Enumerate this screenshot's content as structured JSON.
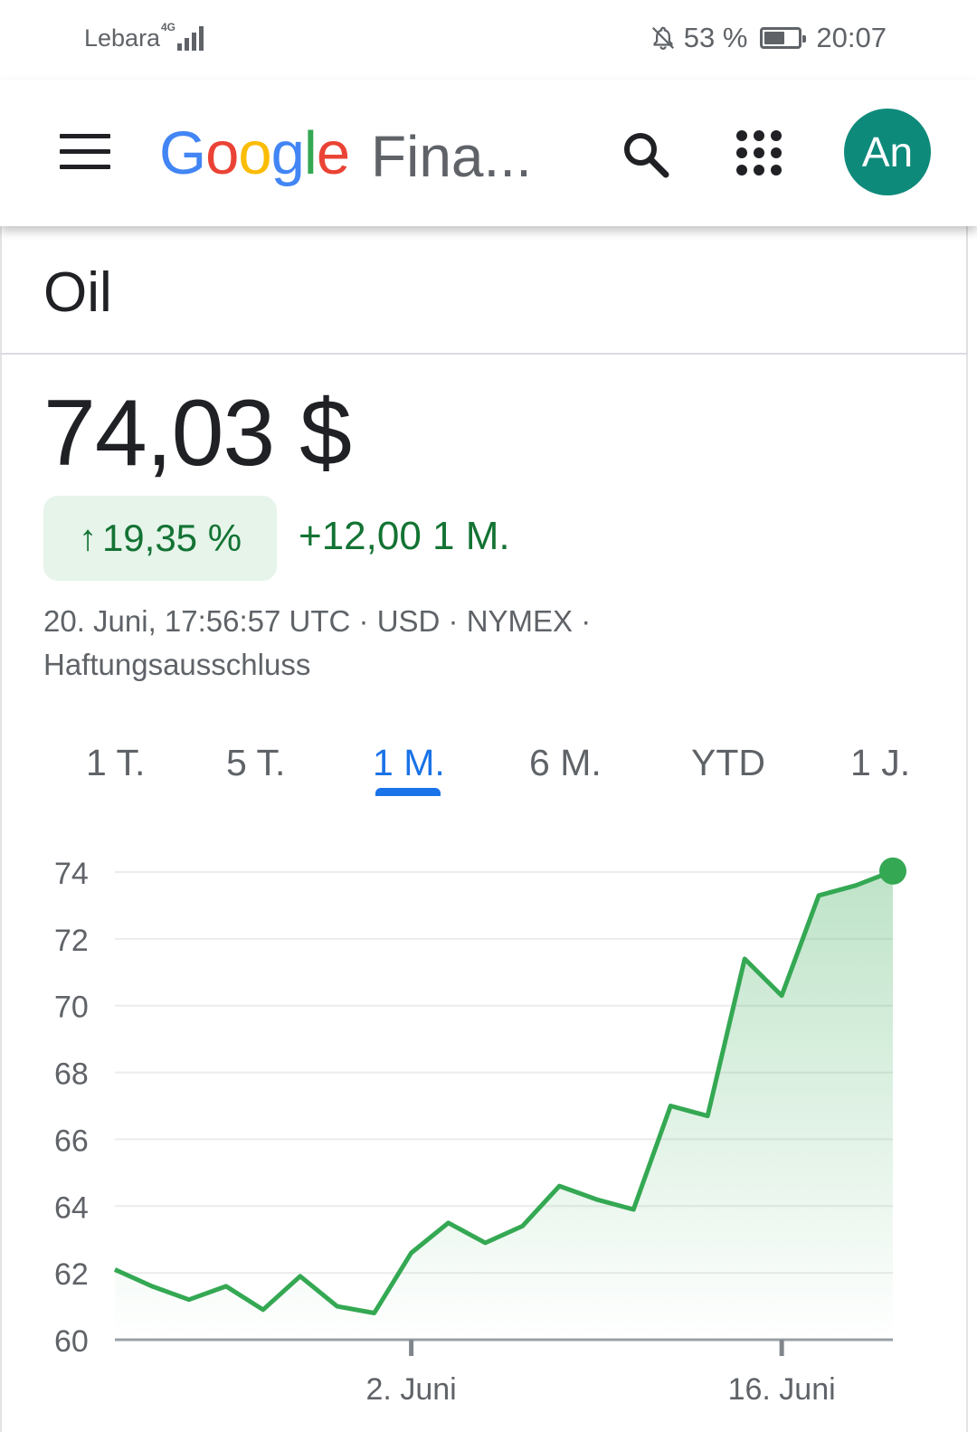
{
  "status_bar": {
    "carrier": "Lebara",
    "network": "4G",
    "battery": "53 %",
    "battery_level": 0.53,
    "time": "20:07"
  },
  "app_bar": {
    "logo": {
      "letters": [
        "G",
        "o",
        "o",
        "g",
        "l",
        "e"
      ]
    },
    "product": "Fina...",
    "avatar_initials": "An",
    "icons": [
      "menu-icon",
      "search-icon",
      "apps-grid-icon",
      "bell-off-icon",
      "signal-icon",
      "battery-icon"
    ]
  },
  "quote": {
    "title": "Oil",
    "price": "74,03 $",
    "change_percent": "19,35 %",
    "change_value": "+12,00 1 M.",
    "meta_line": "20. Juni, 17:56:57 UTC · USD · NYMEX ·",
    "disclaimer": "Haftungsausschluss"
  },
  "tabs": [
    {
      "label": "1 T.",
      "active": false
    },
    {
      "label": "5 T.",
      "active": false
    },
    {
      "label": "1 M.",
      "active": true
    },
    {
      "label": "6 M.",
      "active": false
    },
    {
      "label": "YTD",
      "active": false
    },
    {
      "label": "1 J.",
      "active": false
    }
  ],
  "colors": {
    "positive": "#137333",
    "positive_bg": "#e6f4ea",
    "line": "#34a853",
    "accent": "#1a73e8",
    "avatar": "#0e8a7b"
  },
  "chart_data": {
    "type": "area",
    "y_ticks": [
      "74",
      "72",
      "70",
      "68",
      "66",
      "64",
      "62",
      "60"
    ],
    "ylim": [
      60,
      74
    ],
    "x_ticks": [
      {
        "label": "2. Juni",
        "index": 8
      },
      {
        "label": "16. Juni",
        "index": 18
      }
    ],
    "values": [
      62.1,
      61.6,
      61.2,
      61.6,
      60.9,
      61.9,
      61.0,
      60.8,
      62.6,
      63.5,
      62.9,
      63.4,
      64.6,
      64.2,
      63.9,
      67.0,
      66.7,
      71.4,
      70.3,
      73.3,
      73.6,
      74.03
    ],
    "grid": true,
    "last_point_marker": true
  }
}
